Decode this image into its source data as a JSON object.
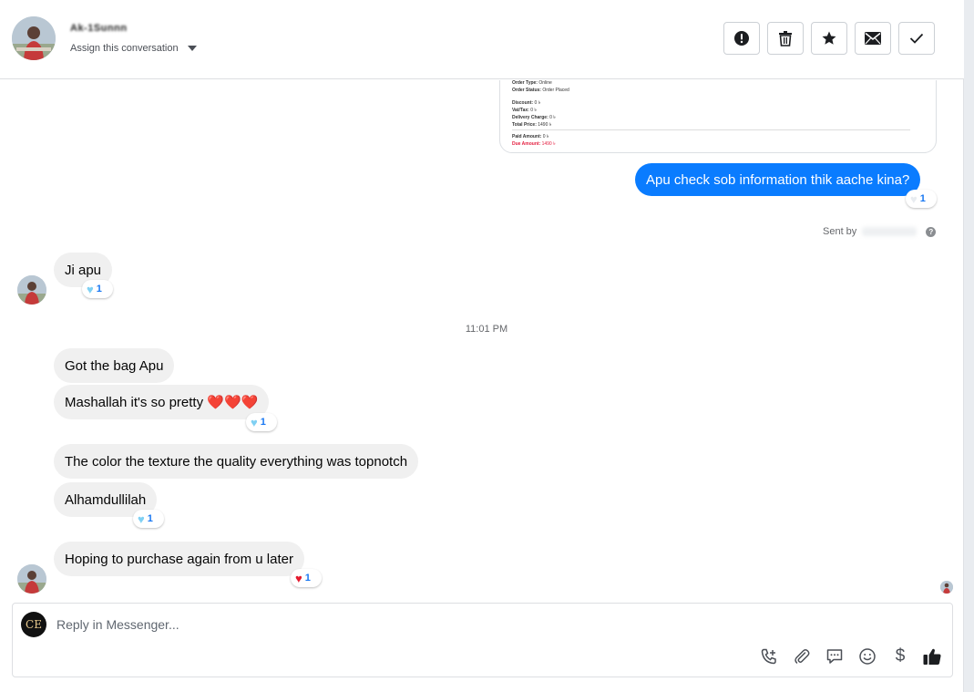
{
  "header": {
    "contact_name": "Ak-1Sunnn",
    "assign_label": "Assign this conversation",
    "actions": [
      {
        "name": "mark-spam",
        "icon": "exclamation-circle-icon"
      },
      {
        "name": "delete",
        "icon": "trash-icon"
      },
      {
        "name": "star",
        "icon": "star-icon"
      },
      {
        "name": "mark-unread",
        "icon": "envelope-icon"
      },
      {
        "name": "mark-done",
        "icon": "check-icon"
      }
    ]
  },
  "receipt": {
    "order_type_label": "Order Type:",
    "order_type": "Online",
    "order_status_label": "Order Status:",
    "order_status": "Order Placed",
    "discount_label": "Discount:",
    "discount": "0 ৳",
    "vat_label": "Vat/Tax:",
    "vat": "0 ৳",
    "delivery_label": "Delivery Charge:",
    "delivery": "0 ৳",
    "total_label": "Total Price:",
    "total": "1490 ৳",
    "paid_label": "Paid Amount:",
    "paid": "0 ৳",
    "due_label": "Due Amount:",
    "due": "1490 ৳"
  },
  "messages": {
    "m1": {
      "text": "Apu check sob information thik aache kina?",
      "reaction_count": "1"
    },
    "sent_by_label": "Sent by",
    "m2": {
      "text": "Ji apu",
      "reaction_count": "1"
    },
    "timestamp": "11:01 PM",
    "m3": {
      "text": "Got the bag Apu"
    },
    "m4": {
      "text": "Mashallah it's so pretty ❤️❤️❤️",
      "reaction_count": "1"
    },
    "m5": {
      "text": "The color the texture the quality everything was topnotch"
    },
    "m6": {
      "text": "Alhamdullilah",
      "reaction_count": "1"
    },
    "m7": {
      "text": "Hoping to purchase again from u later",
      "reaction_count": "1"
    }
  },
  "composer": {
    "page_avatar_initials": "CE",
    "placeholder": "Reply in Messenger...",
    "icons": [
      "phone-add-icon",
      "paperclip-icon",
      "saved-reply-icon",
      "emoji-icon",
      "dollar-icon",
      "thumbs-up-icon"
    ]
  },
  "colors": {
    "outgoing_bubble": "#0a7cff",
    "incoming_bubble": "#f0f0f0",
    "reaction_count": "#1877f2",
    "due_amount": "#e41e3f"
  }
}
